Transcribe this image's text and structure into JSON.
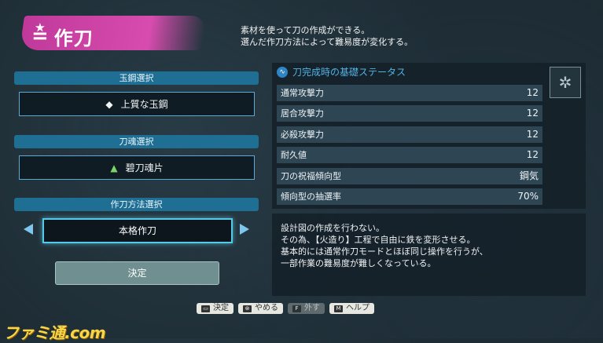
{
  "header": {
    "title": "作刀",
    "icon": "blacksmith-icon"
  },
  "intro": [
    "素材を使って刀の作成ができる。",
    "選んだ作刀方法によって難易度が変化する。"
  ],
  "sections": {
    "steel": {
      "label": "玉鋼選択",
      "value": "上質な玉鋼",
      "icon": "steel-icon"
    },
    "soul": {
      "label": "刀魂選択",
      "value": "碧刀魂片",
      "icon": "soul-shard-icon"
    },
    "method": {
      "label": "作刀方法選択",
      "value": "本格作刀"
    }
  },
  "confirm_label": "決定",
  "stats": {
    "title": "刀完成時の基礎ステータス",
    "rows": [
      {
        "label": "通常攻撃力",
        "value": "12"
      },
      {
        "label": "居合攻撃力",
        "value": "12"
      },
      {
        "label": "必殺攻撃力",
        "value": "12"
      },
      {
        "label": "耐久値",
        "value": "12"
      },
      {
        "label": "刀の祝福傾向型",
        "value": "鋼気"
      },
      {
        "label": "傾向型の抽選率",
        "value": "70%"
      }
    ]
  },
  "description": [
    "設計図の作成を行わない。",
    "その為、【火造り】工程で自由に鉄を変形させる。",
    "基本的には通常作刀モードとほぼ同じ操作を行うが、",
    "一部作業の難易度が難しくなっている。"
  ],
  "footer": [
    {
      "key": "▭",
      "label": "決定",
      "enabled": true
    },
    {
      "key": "⊗",
      "label": "やめる",
      "enabled": true
    },
    {
      "key": "F",
      "label": "外す",
      "enabled": false
    },
    {
      "key": "M",
      "label": "ヘルプ",
      "enabled": true
    }
  ],
  "watermark": "ファミ通.com",
  "colors": {
    "accent": "#1f6f95",
    "highlight": "#55c9e8",
    "brush": "#d74cae"
  }
}
